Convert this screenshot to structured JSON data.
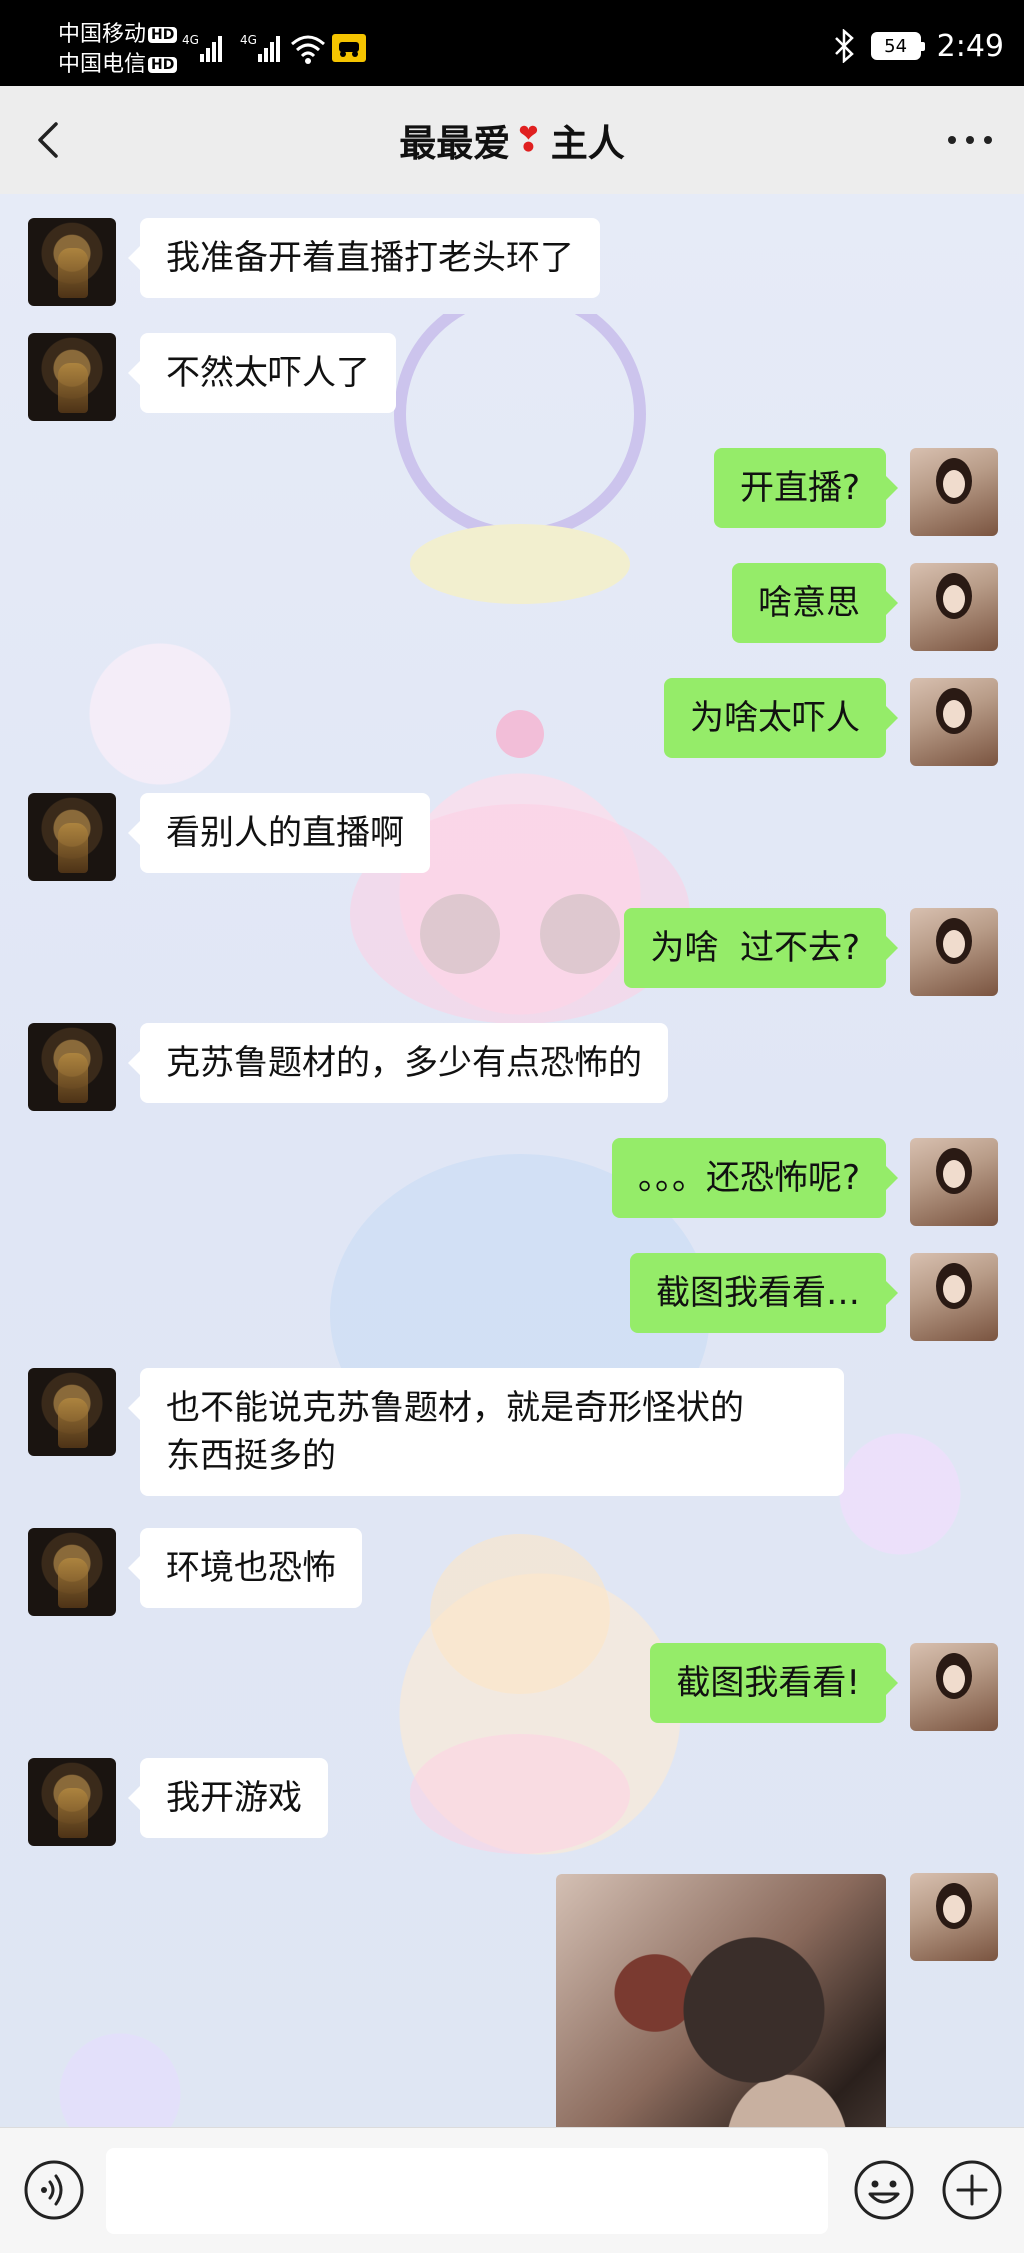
{
  "status_bar": {
    "carrier_1": "中国移动",
    "carrier_2": "中国电信",
    "hd_badge": "HD",
    "network_1": "4G",
    "network_2": "4G",
    "battery": "54",
    "time": "2:49"
  },
  "header": {
    "title_part1": "最最爱",
    "heart": "❣",
    "title_part2": "主人"
  },
  "messages": [
    {
      "side": "in",
      "text": "我准备开着直播打老头环了"
    },
    {
      "side": "in",
      "text": "不然太吓人了"
    },
    {
      "side": "out",
      "text": "开直播?"
    },
    {
      "side": "out",
      "text": "啥意思"
    },
    {
      "side": "out",
      "text": "为啥太吓人"
    },
    {
      "side": "in",
      "text": "看别人的直播啊"
    },
    {
      "side": "out",
      "text": "为啥  过不去?"
    },
    {
      "side": "in",
      "text": "克苏鲁题材的，多少有点恐怖的"
    },
    {
      "side": "out",
      "text": "。。。还恐怖呢?"
    },
    {
      "side": "out",
      "text": "截图我看看…"
    },
    {
      "side": "in",
      "text": "也不能说克苏鲁题材，就是奇形怪状的\n东西挺多的"
    },
    {
      "side": "in",
      "text": "环境也恐怖"
    },
    {
      "side": "out",
      "text": "截图我看看!"
    },
    {
      "side": "in",
      "text": "我开游戏"
    },
    {
      "side": "out",
      "type": "image",
      "text": ""
    }
  ],
  "input_bar": {
    "placeholder": "",
    "value": ""
  },
  "colors": {
    "outgoing_bubble": "#95ec69",
    "incoming_bubble": "#ffffff",
    "header_bg": "#ededed",
    "status_bar_bg": "#000000"
  },
  "icons": {
    "back": "chevron-left-icon",
    "more": "more-dots-icon",
    "voice": "voice-icon",
    "emoji": "emoji-icon",
    "plus": "plus-icon"
  }
}
